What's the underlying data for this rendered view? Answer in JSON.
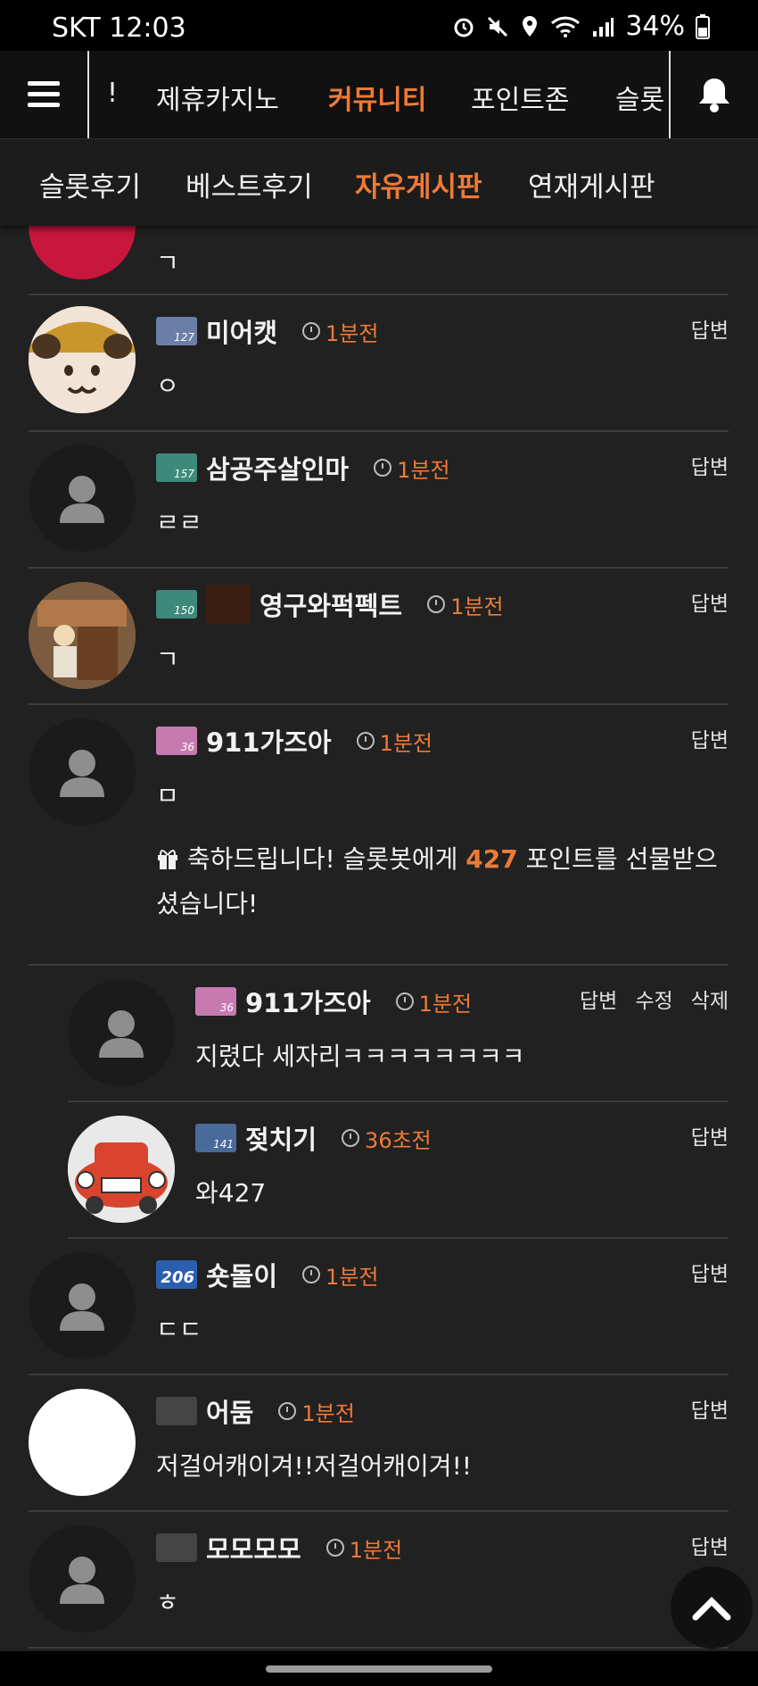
{
  "status": {
    "carrier": "SKT 12:03",
    "battery": "34%"
  },
  "topnav": {
    "items": [
      "!",
      "제휴카지노",
      "커뮤니티",
      "포인트존",
      "슬롯"
    ],
    "active_index": 2
  },
  "subnav": {
    "items": [
      "슬롯후기",
      "베스트후기",
      "자유게시판",
      "연재게시판"
    ],
    "active_index": 2
  },
  "comments": [
    {
      "nick": "",
      "level": "",
      "time": "",
      "text": "ㄱ",
      "actions": []
    },
    {
      "nick": "미어캣",
      "level": "127",
      "time": "1분전",
      "text": "ㅇ",
      "actions": [
        "답변"
      ]
    },
    {
      "nick": "삼공주살인마",
      "level": "157",
      "time": "1분전",
      "text": "ㄹㄹ",
      "actions": [
        "답변"
      ]
    },
    {
      "nick": "영구와퍽펙트",
      "level": "150",
      "time": "1분전",
      "text": "ㄱ",
      "actions": [
        "답변"
      ]
    },
    {
      "nick": "911가즈아",
      "level": "36",
      "time": "1분전",
      "text": "ㅁ",
      "actions": [
        "답변"
      ],
      "gift": {
        "before": "축하드립니다! 슬롯봇에게 ",
        "points": "427",
        "after": " 포인트를 선물받으셨습니다!"
      }
    },
    {
      "nick": "911가즈아",
      "level": "36",
      "time": "1분전",
      "text": "지렸다 세자리ㅋㅋㅋㅋㅋㅋㅋㅋ",
      "actions": [
        "답변",
        "수정",
        "삭제"
      ]
    },
    {
      "nick": "젖치기",
      "level": "141",
      "time": "36초전",
      "text": "와427",
      "actions": [
        "답변"
      ]
    },
    {
      "nick": "숏돌이",
      "level": "206",
      "time": "1분전",
      "text": "ㄷㄷ",
      "actions": [
        "답변"
      ]
    },
    {
      "nick": "어둠",
      "level": "",
      "time": "1분전",
      "text": "저걸어캐이겨!!저걸어캐이겨!!",
      "actions": [
        "답변"
      ]
    },
    {
      "nick": "모모모모",
      "level": "",
      "time": "1분전",
      "text": "ㅎ",
      "actions": [
        "답변"
      ]
    }
  ]
}
